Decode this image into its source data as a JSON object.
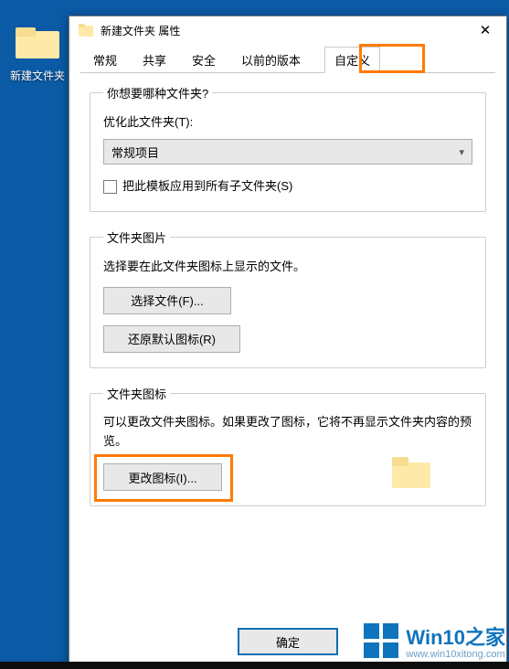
{
  "desktop": {
    "folder_label": "新建文件夹"
  },
  "window": {
    "title": "新建文件夹 属性",
    "close": "✕"
  },
  "tabs": {
    "general": "常规",
    "share": "共享",
    "security": "安全",
    "previous": "以前的版本",
    "customize": "自定义"
  },
  "group1": {
    "legend": "你想要哪种文件夹?",
    "optimize_label": "优化此文件夹(T):",
    "select_value": "常规项目",
    "apply_checkbox": "把此模板应用到所有子文件夹(S)"
  },
  "group2": {
    "legend": "文件夹图片",
    "desc": "选择要在此文件夹图标上显示的文件。",
    "choose_btn": "选择文件(F)...",
    "restore_btn": "还原默认图标(R)"
  },
  "group3": {
    "legend": "文件夹图标",
    "desc": "可以更改文件夹图标。如果更改了图标，它将不再显示文件夹内容的预览。",
    "change_btn": "更改图标(I)..."
  },
  "footer": {
    "ok": "确定"
  },
  "watermark": {
    "brand": "Win10之家",
    "url": "www.win10xitong.com"
  }
}
